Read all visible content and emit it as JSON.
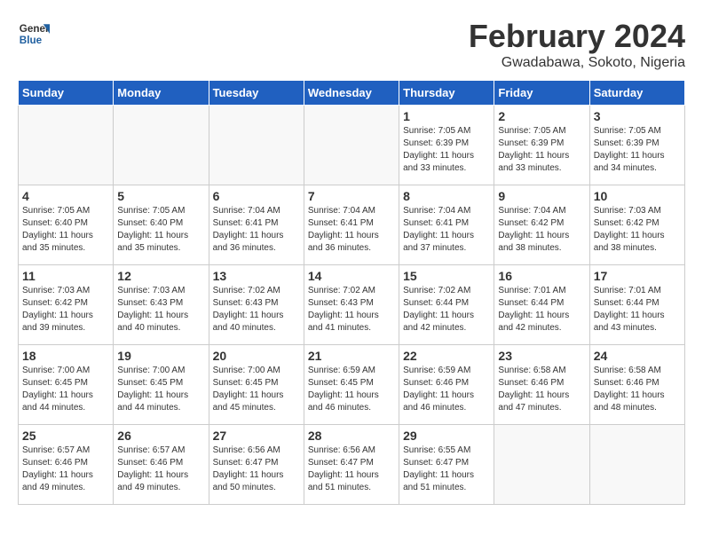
{
  "header": {
    "logo_general": "General",
    "logo_blue": "Blue",
    "month_year": "February 2024",
    "subtitle": "Gwadabawa, Sokoto, Nigeria"
  },
  "weekdays": [
    "Sunday",
    "Monday",
    "Tuesday",
    "Wednesday",
    "Thursday",
    "Friday",
    "Saturday"
  ],
  "weeks": [
    [
      {
        "day": "",
        "detail": ""
      },
      {
        "day": "",
        "detail": ""
      },
      {
        "day": "",
        "detail": ""
      },
      {
        "day": "",
        "detail": ""
      },
      {
        "day": "1",
        "detail": "Sunrise: 7:05 AM\nSunset: 6:39 PM\nDaylight: 11 hours\nand 33 minutes."
      },
      {
        "day": "2",
        "detail": "Sunrise: 7:05 AM\nSunset: 6:39 PM\nDaylight: 11 hours\nand 33 minutes."
      },
      {
        "day": "3",
        "detail": "Sunrise: 7:05 AM\nSunset: 6:39 PM\nDaylight: 11 hours\nand 34 minutes."
      }
    ],
    [
      {
        "day": "4",
        "detail": "Sunrise: 7:05 AM\nSunset: 6:40 PM\nDaylight: 11 hours\nand 35 minutes."
      },
      {
        "day": "5",
        "detail": "Sunrise: 7:05 AM\nSunset: 6:40 PM\nDaylight: 11 hours\nand 35 minutes."
      },
      {
        "day": "6",
        "detail": "Sunrise: 7:04 AM\nSunset: 6:41 PM\nDaylight: 11 hours\nand 36 minutes."
      },
      {
        "day": "7",
        "detail": "Sunrise: 7:04 AM\nSunset: 6:41 PM\nDaylight: 11 hours\nand 36 minutes."
      },
      {
        "day": "8",
        "detail": "Sunrise: 7:04 AM\nSunset: 6:41 PM\nDaylight: 11 hours\nand 37 minutes."
      },
      {
        "day": "9",
        "detail": "Sunrise: 7:04 AM\nSunset: 6:42 PM\nDaylight: 11 hours\nand 38 minutes."
      },
      {
        "day": "10",
        "detail": "Sunrise: 7:03 AM\nSunset: 6:42 PM\nDaylight: 11 hours\nand 38 minutes."
      }
    ],
    [
      {
        "day": "11",
        "detail": "Sunrise: 7:03 AM\nSunset: 6:42 PM\nDaylight: 11 hours\nand 39 minutes."
      },
      {
        "day": "12",
        "detail": "Sunrise: 7:03 AM\nSunset: 6:43 PM\nDaylight: 11 hours\nand 40 minutes."
      },
      {
        "day": "13",
        "detail": "Sunrise: 7:02 AM\nSunset: 6:43 PM\nDaylight: 11 hours\nand 40 minutes."
      },
      {
        "day": "14",
        "detail": "Sunrise: 7:02 AM\nSunset: 6:43 PM\nDaylight: 11 hours\nand 41 minutes."
      },
      {
        "day": "15",
        "detail": "Sunrise: 7:02 AM\nSunset: 6:44 PM\nDaylight: 11 hours\nand 42 minutes."
      },
      {
        "day": "16",
        "detail": "Sunrise: 7:01 AM\nSunset: 6:44 PM\nDaylight: 11 hours\nand 42 minutes."
      },
      {
        "day": "17",
        "detail": "Sunrise: 7:01 AM\nSunset: 6:44 PM\nDaylight: 11 hours\nand 43 minutes."
      }
    ],
    [
      {
        "day": "18",
        "detail": "Sunrise: 7:00 AM\nSunset: 6:45 PM\nDaylight: 11 hours\nand 44 minutes."
      },
      {
        "day": "19",
        "detail": "Sunrise: 7:00 AM\nSunset: 6:45 PM\nDaylight: 11 hours\nand 44 minutes."
      },
      {
        "day": "20",
        "detail": "Sunrise: 7:00 AM\nSunset: 6:45 PM\nDaylight: 11 hours\nand 45 minutes."
      },
      {
        "day": "21",
        "detail": "Sunrise: 6:59 AM\nSunset: 6:45 PM\nDaylight: 11 hours\nand 46 minutes."
      },
      {
        "day": "22",
        "detail": "Sunrise: 6:59 AM\nSunset: 6:46 PM\nDaylight: 11 hours\nand 46 minutes."
      },
      {
        "day": "23",
        "detail": "Sunrise: 6:58 AM\nSunset: 6:46 PM\nDaylight: 11 hours\nand 47 minutes."
      },
      {
        "day": "24",
        "detail": "Sunrise: 6:58 AM\nSunset: 6:46 PM\nDaylight: 11 hours\nand 48 minutes."
      }
    ],
    [
      {
        "day": "25",
        "detail": "Sunrise: 6:57 AM\nSunset: 6:46 PM\nDaylight: 11 hours\nand 49 minutes."
      },
      {
        "day": "26",
        "detail": "Sunrise: 6:57 AM\nSunset: 6:46 PM\nDaylight: 11 hours\nand 49 minutes."
      },
      {
        "day": "27",
        "detail": "Sunrise: 6:56 AM\nSunset: 6:47 PM\nDaylight: 11 hours\nand 50 minutes."
      },
      {
        "day": "28",
        "detail": "Sunrise: 6:56 AM\nSunset: 6:47 PM\nDaylight: 11 hours\nand 51 minutes."
      },
      {
        "day": "29",
        "detail": "Sunrise: 6:55 AM\nSunset: 6:47 PM\nDaylight: 11 hours\nand 51 minutes."
      },
      {
        "day": "",
        "detail": ""
      },
      {
        "day": "",
        "detail": ""
      }
    ]
  ]
}
